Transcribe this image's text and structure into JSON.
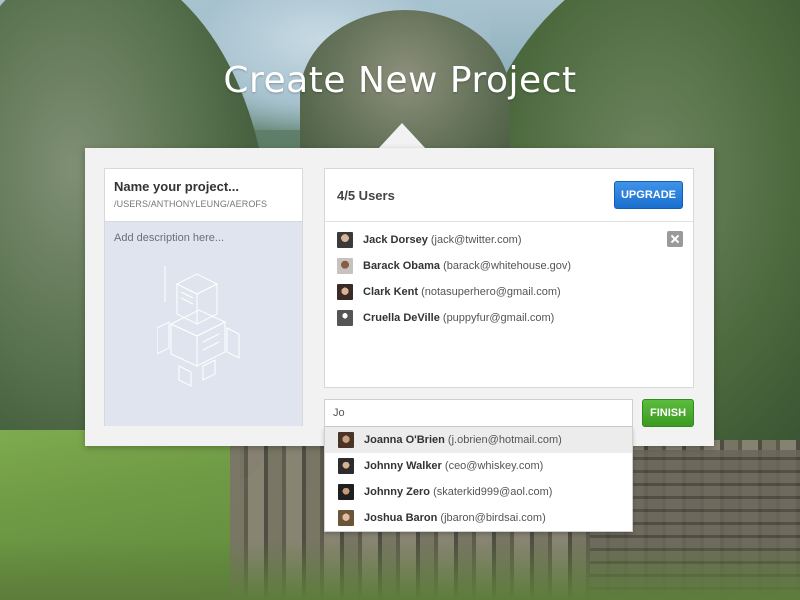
{
  "page": {
    "title": "Create New Project"
  },
  "project": {
    "name_placeholder": "Name your project...",
    "path": "/USERS/ANTHONYLEUNG/AEROFS",
    "description_placeholder": "Add description here..."
  },
  "users": {
    "count_label": "4/5 Users",
    "upgrade_label": "UPGRADE",
    "list": [
      {
        "name": "Jack Dorsey",
        "email": "(jack@twitter.com)",
        "avatar": "avatar-jack"
      },
      {
        "name": "Barack Obama",
        "email": "(barack@whitehouse.gov)",
        "avatar": "avatar-barack"
      },
      {
        "name": "Clark Kent",
        "email": "(notasuperhero@gmail.com)",
        "avatar": "avatar-clark"
      },
      {
        "name": "Cruella DeVille",
        "email": "(puppyfur@gmail.com)",
        "avatar": "avatar-default"
      }
    ]
  },
  "search": {
    "value": "Jo"
  },
  "finish_label": "FINISH",
  "suggestions": [
    {
      "name": "Joanna O'Brien",
      "email": "(j.obrien@hotmail.com)",
      "active": true
    },
    {
      "name": "Johnny Walker",
      "email": "(ceo@whiskey.com)",
      "active": false
    },
    {
      "name": "Johnny Zero",
      "email": "(skaterkid999@aol.com)",
      "active": false
    },
    {
      "name": "Joshua Baron",
      "email": "(jbaron@birdsai.com)",
      "active": false
    }
  ],
  "colors": {
    "upgrade": "#1a6fcf",
    "finish": "#3b9a22",
    "description_bg": "#dfe4ee"
  }
}
